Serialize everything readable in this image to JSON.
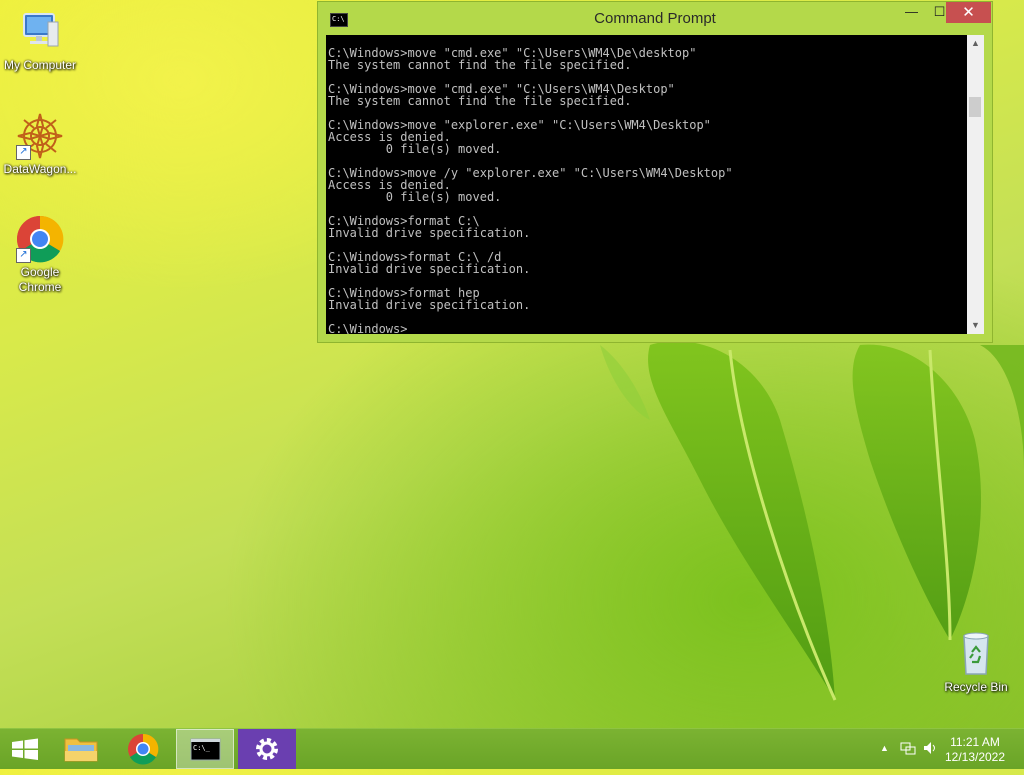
{
  "desktop": {
    "icons": [
      {
        "label": "My Computer",
        "icon": "computer-icon"
      },
      {
        "label": "DataWagon...",
        "icon": "datawagon-icon"
      },
      {
        "label": "Google Chrome",
        "icon": "chrome-icon"
      },
      {
        "label": "Recycle Bin",
        "icon": "recycle-bin-icon"
      }
    ]
  },
  "cmd_window": {
    "title": "Command Prompt",
    "controls": {
      "minimize": "—",
      "maximize": "☐",
      "close": "✕"
    },
    "lines": [
      "C:\\Windows>move \"cmd.exe\" \"C:\\Users\\WM4\\De\\desktop\"",
      "The system cannot find the file specified.",
      "",
      "C:\\Windows>move \"cmd.exe\" \"C:\\Users\\WM4\\Desktop\"",
      "The system cannot find the file specified.",
      "",
      "C:\\Windows>move \"explorer.exe\" \"C:\\Users\\WM4\\Desktop\"",
      "Access is denied.",
      "        0 file(s) moved.",
      "",
      "C:\\Windows>move /y \"explorer.exe\" \"C:\\Users\\WM4\\Desktop\"",
      "Access is denied.",
      "        0 file(s) moved.",
      "",
      "C:\\Windows>format C:\\",
      "Invalid drive specification.",
      "",
      "C:\\Windows>format C:\\ /d",
      "Invalid drive specification.",
      "",
      "C:\\Windows>format hep",
      "Invalid drive specification.",
      "",
      "C:\\Windows>"
    ]
  },
  "taskbar": {
    "items": [
      "start-button",
      "file-explorer",
      "google-chrome",
      "command-prompt",
      "settings"
    ],
    "active": "command-prompt",
    "tray": {
      "show_hidden_icon": "▲",
      "time": "11:21 AM",
      "date": "12/13/2022"
    }
  },
  "colors": {
    "taskbar": "#6aa427",
    "window_frame": "#b4d94a",
    "close_button": "#c75050",
    "console_bg": "#000000",
    "console_text": "#c0c0c0"
  }
}
